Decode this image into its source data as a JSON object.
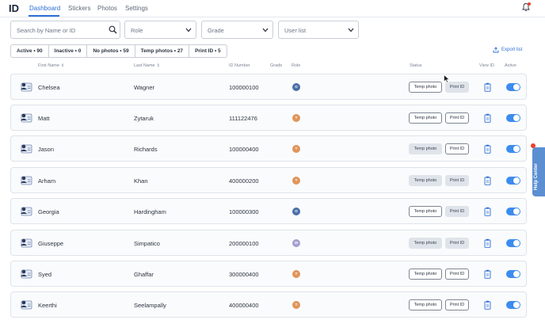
{
  "app": {
    "logo": "ID"
  },
  "tabs": [
    "Dashboard",
    "Stickers",
    "Photos",
    "Settings"
  ],
  "filters": {
    "search_placeholder": "Search by Name or ID",
    "role": "Role",
    "grade": "Grade",
    "user_list": "User list"
  },
  "chips": [
    "Active • 90",
    "Inactive • 0",
    "No photos • 59",
    "Temp photos • 27",
    "Print ID • 5"
  ],
  "export_label": "Export list",
  "columns": {
    "first_name": "First Name",
    "last_name": "Last Name",
    "id_number": "ID Number",
    "grade": "Grade",
    "role": "Role",
    "status": "Status",
    "view_id": "View ID",
    "active": "Active"
  },
  "buttons": {
    "temp_photo": "Temp photo",
    "print_id": "Print ID"
  },
  "rows": [
    {
      "first": "Chelsea",
      "last": "Wagner",
      "id": "100000100",
      "role": "O",
      "temp_muted": false,
      "print_muted": true
    },
    {
      "first": "Matt",
      "last": "Zytaruk",
      "id": "111122476",
      "role": "T",
      "temp_muted": false,
      "print_muted": false
    },
    {
      "first": "Jason",
      "last": "Richards",
      "id": "100000400",
      "role": "T",
      "temp_muted": true,
      "print_muted": false
    },
    {
      "first": "Arham",
      "last": "Khan",
      "id": "400000200",
      "role": "T",
      "temp_muted": true,
      "print_muted": true
    },
    {
      "first": "Georgia",
      "last": "Hardingham",
      "id": "100000300",
      "role": "O",
      "temp_muted": false,
      "print_muted": true
    },
    {
      "first": "Giuseppe",
      "last": "Simpatico",
      "id": "200000100",
      "role": "M",
      "temp_muted": true,
      "print_muted": true
    },
    {
      "first": "Syed",
      "last": "Ghaffar",
      "id": "300000400",
      "role": "T",
      "temp_muted": false,
      "print_muted": false
    },
    {
      "first": "Keerthi",
      "last": "Seelampally",
      "id": "400000400",
      "role": "T",
      "temp_muted": false,
      "print_muted": false
    }
  ],
  "role_colors": {
    "O": "#4a6fa8",
    "T": "#e0955a",
    "M": "#a4a0cf"
  },
  "accent": "#2f6fd6",
  "help_label": "Help Center"
}
